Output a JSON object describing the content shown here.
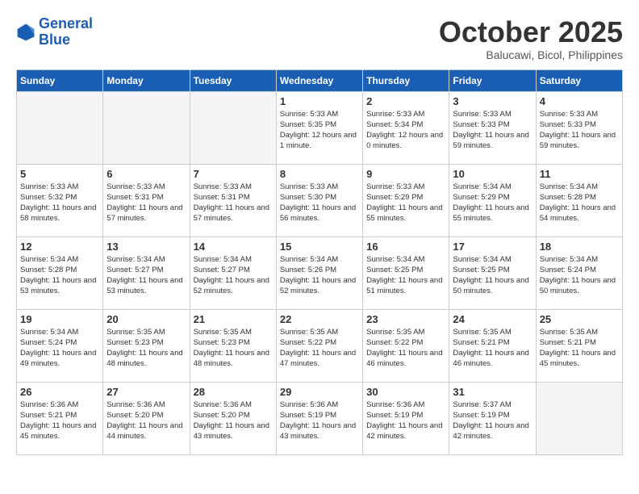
{
  "header": {
    "logo_line1": "General",
    "logo_line2": "Blue",
    "month": "October 2025",
    "location": "Balucawi, Bicol, Philippines"
  },
  "weekdays": [
    "Sunday",
    "Monday",
    "Tuesday",
    "Wednesday",
    "Thursday",
    "Friday",
    "Saturday"
  ],
  "weeks": [
    [
      {
        "day": "",
        "info": ""
      },
      {
        "day": "",
        "info": ""
      },
      {
        "day": "",
        "info": ""
      },
      {
        "day": "1",
        "info": "Sunrise: 5:33 AM\nSunset: 5:35 PM\nDaylight: 12 hours and 1 minute."
      },
      {
        "day": "2",
        "info": "Sunrise: 5:33 AM\nSunset: 5:34 PM\nDaylight: 12 hours and 0 minutes."
      },
      {
        "day": "3",
        "info": "Sunrise: 5:33 AM\nSunset: 5:33 PM\nDaylight: 11 hours and 59 minutes."
      },
      {
        "day": "4",
        "info": "Sunrise: 5:33 AM\nSunset: 5:33 PM\nDaylight: 11 hours and 59 minutes."
      }
    ],
    [
      {
        "day": "5",
        "info": "Sunrise: 5:33 AM\nSunset: 5:32 PM\nDaylight: 11 hours and 58 minutes."
      },
      {
        "day": "6",
        "info": "Sunrise: 5:33 AM\nSunset: 5:31 PM\nDaylight: 11 hours and 57 minutes."
      },
      {
        "day": "7",
        "info": "Sunrise: 5:33 AM\nSunset: 5:31 PM\nDaylight: 11 hours and 57 minutes."
      },
      {
        "day": "8",
        "info": "Sunrise: 5:33 AM\nSunset: 5:30 PM\nDaylight: 11 hours and 56 minutes."
      },
      {
        "day": "9",
        "info": "Sunrise: 5:33 AM\nSunset: 5:29 PM\nDaylight: 11 hours and 55 minutes."
      },
      {
        "day": "10",
        "info": "Sunrise: 5:34 AM\nSunset: 5:29 PM\nDaylight: 11 hours and 55 minutes."
      },
      {
        "day": "11",
        "info": "Sunrise: 5:34 AM\nSunset: 5:28 PM\nDaylight: 11 hours and 54 minutes."
      }
    ],
    [
      {
        "day": "12",
        "info": "Sunrise: 5:34 AM\nSunset: 5:28 PM\nDaylight: 11 hours and 53 minutes."
      },
      {
        "day": "13",
        "info": "Sunrise: 5:34 AM\nSunset: 5:27 PM\nDaylight: 11 hours and 53 minutes."
      },
      {
        "day": "14",
        "info": "Sunrise: 5:34 AM\nSunset: 5:27 PM\nDaylight: 11 hours and 52 minutes."
      },
      {
        "day": "15",
        "info": "Sunrise: 5:34 AM\nSunset: 5:26 PM\nDaylight: 11 hours and 52 minutes."
      },
      {
        "day": "16",
        "info": "Sunrise: 5:34 AM\nSunset: 5:25 PM\nDaylight: 11 hours and 51 minutes."
      },
      {
        "day": "17",
        "info": "Sunrise: 5:34 AM\nSunset: 5:25 PM\nDaylight: 11 hours and 50 minutes."
      },
      {
        "day": "18",
        "info": "Sunrise: 5:34 AM\nSunset: 5:24 PM\nDaylight: 11 hours and 50 minutes."
      }
    ],
    [
      {
        "day": "19",
        "info": "Sunrise: 5:34 AM\nSunset: 5:24 PM\nDaylight: 11 hours and 49 minutes."
      },
      {
        "day": "20",
        "info": "Sunrise: 5:35 AM\nSunset: 5:23 PM\nDaylight: 11 hours and 48 minutes."
      },
      {
        "day": "21",
        "info": "Sunrise: 5:35 AM\nSunset: 5:23 PM\nDaylight: 11 hours and 48 minutes."
      },
      {
        "day": "22",
        "info": "Sunrise: 5:35 AM\nSunset: 5:22 PM\nDaylight: 11 hours and 47 minutes."
      },
      {
        "day": "23",
        "info": "Sunrise: 5:35 AM\nSunset: 5:22 PM\nDaylight: 11 hours and 46 minutes."
      },
      {
        "day": "24",
        "info": "Sunrise: 5:35 AM\nSunset: 5:21 PM\nDaylight: 11 hours and 46 minutes."
      },
      {
        "day": "25",
        "info": "Sunrise: 5:35 AM\nSunset: 5:21 PM\nDaylight: 11 hours and 45 minutes."
      }
    ],
    [
      {
        "day": "26",
        "info": "Sunrise: 5:36 AM\nSunset: 5:21 PM\nDaylight: 11 hours and 45 minutes."
      },
      {
        "day": "27",
        "info": "Sunrise: 5:36 AM\nSunset: 5:20 PM\nDaylight: 11 hours and 44 minutes."
      },
      {
        "day": "28",
        "info": "Sunrise: 5:36 AM\nSunset: 5:20 PM\nDaylight: 11 hours and 43 minutes."
      },
      {
        "day": "29",
        "info": "Sunrise: 5:36 AM\nSunset: 5:19 PM\nDaylight: 11 hours and 43 minutes."
      },
      {
        "day": "30",
        "info": "Sunrise: 5:36 AM\nSunset: 5:19 PM\nDaylight: 11 hours and 42 minutes."
      },
      {
        "day": "31",
        "info": "Sunrise: 5:37 AM\nSunset: 5:19 PM\nDaylight: 11 hours and 42 minutes."
      },
      {
        "day": "",
        "info": ""
      }
    ]
  ]
}
